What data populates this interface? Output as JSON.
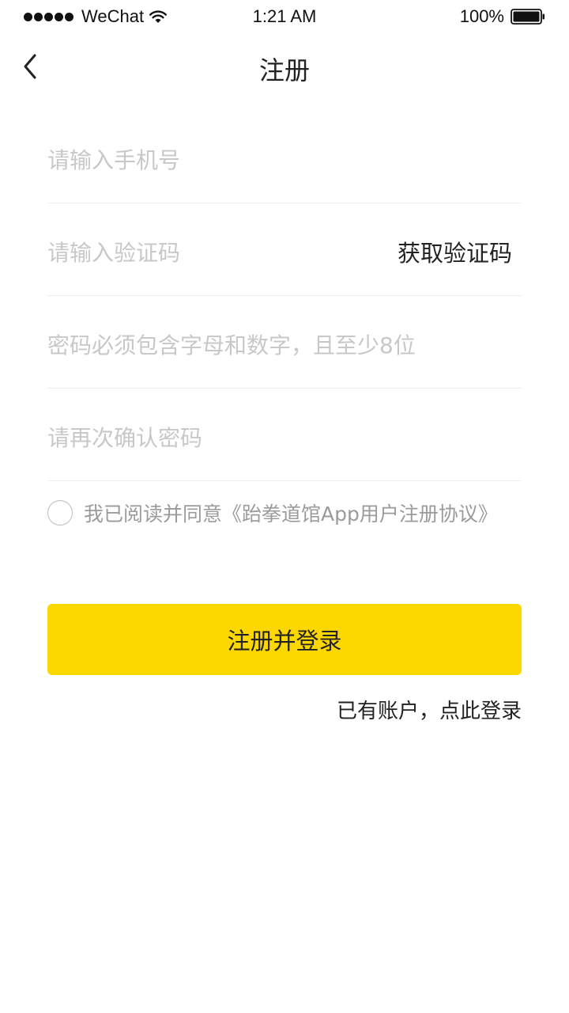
{
  "status_bar": {
    "carrier": "WeChat",
    "time": "1:21 AM",
    "battery": "100%"
  },
  "nav": {
    "title": "注册",
    "back_icon": "chevron-left-icon"
  },
  "form": {
    "phone_placeholder": "请输入手机号",
    "code_placeholder": "请输入验证码",
    "get_code_label": "获取验证码",
    "password_placeholder": "密码必须包含字母和数字，且至少8位",
    "confirm_placeholder": "请再次确认密码"
  },
  "agreement": {
    "text": "我已阅读并同意《跆拳道馆App用户注册协议》",
    "checked": false
  },
  "actions": {
    "submit_label": "注册并登录",
    "login_link": "已有账户，点此登录"
  },
  "colors": {
    "accent": "#fcd800",
    "placeholder": "#c8c8c8",
    "divider": "#eeeeee"
  }
}
